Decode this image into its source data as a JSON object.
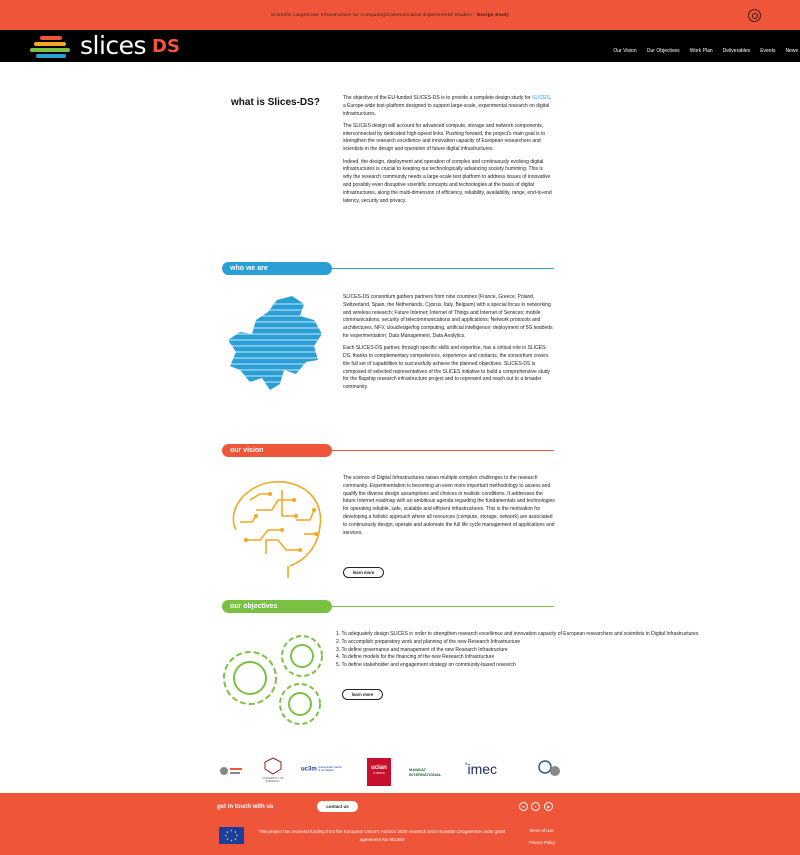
{
  "topbar": {
    "tagline_prefix": "Scientific LargeScale Infrastructure for Computing/Communication Experimental Studies - ",
    "tagline_bold": "Design Study"
  },
  "brand": {
    "name": "slices",
    "suffix": "DS",
    "bar_colors": [
      "#ee5539",
      "#f5a623",
      "#7ac143",
      "#2a9fd6"
    ]
  },
  "nav": {
    "items": [
      "Our Vision",
      "Our Objectives",
      "Work Plan",
      "Deliverables",
      "Events",
      "News"
    ]
  },
  "what": {
    "title": "what is Slices-DS?",
    "p1_pre": "The objective of the EU-funded SLICES-DS is to provide a complete design study for ",
    "p1_link": "SLICES",
    "p1_post": ", a Europe-wide test-platform designed to support large-scale, experimental research on digital infrastructures.",
    "p2": "The SLICES design will account for advanced compute, storage and network components, interconnected by dedicated high-speed links. Pushing forward, the project's main goal is to strengthen the research excellence and innovation capacity of European researchers and scientists in the design and operation of future digital infrastructures.",
    "p3": "Indeed, the design, deployment and operation of complex and continuously evolving digital infrastructures is crucial to keeping our technologically advancing society humming. This is why the research community needs a large-scale test platform to address issues of innovative and possibly even disruptive scientific concepts and technologies at the basis of digital infrastructures, along the multi-dimension of efficiency, reliability, availability, range, end-to-end latency, security and privacy."
  },
  "who": {
    "title": "who we are",
    "color": "#2a9fd6",
    "p1": "SLICES-DS consortium gathers partners from nine countries (France, Greece, Poland, Switzerland, Spain, the Netherlands, Cyprus, Italy, Belgium) with a special focus in networking and wireless research; Future Internet; Internet of Things and Internet of Services; mobile communications, security of telecommunications and applications; Network protocols and architectures, NFV, cloud/edge/fog computing, artificial intelligence; deployment of 5G testbeds for experimentation; Data Management, Data Analytics.",
    "p2": "Each SLICES-DS partner, through specific skills and expertise, has a critical role in SLICES-DS, thanks to complementary competences, experience and contacts, the consortium covers the full set of capabilities to successfully achieve the planned objectives. SLICES-DS is composed of selected representatives of the SLICES initiative to build a comprehensive study for the flagship research infrastructure project and to represent and reach out to a broader community."
  },
  "vision": {
    "title": "our vision",
    "color": "#ee5539",
    "text": "The science of Digital Infrastructures raises multiple complex challenges to the research community. Experimentation is becoming an even more important methodology to assess and qualify the diverse design assumptions and choices in realistic conditions. It addresses the future Internet roadmap with an ambitious agenda regarding the fundamentals and technologies for operating reliable, safe, scalable and efficient infrastructures. This is the motivation for developing a holistic approach where all resources (compute, storage, network) are associated to continuously design, operate and automate the full life cycle management of applications and services.",
    "button": "learn more"
  },
  "objectives": {
    "title": "our objectives",
    "color": "#7ac143",
    "items": [
      "1. To adequately design SLICES in order to strengthen research excellence and innovation capacity of European researchers and scientists in Digital Infrastructures",
      "2. To accomplish preparatory work and planning of the new Research Infrastructure",
      "3. To define governance and management of the new Research Infrastructure",
      "4. To define models for the financing of the new Research Infrastructure",
      "5. To define stakeholder and engagement strategy on community-based research"
    ],
    "button": "learn more"
  },
  "partners": {
    "thessaly": "UNIVERSITY OF THESSALY",
    "uc3m": "uc3m",
    "uc3m_sub": "Universidad Carlos III de Madrid",
    "uclan": "uclan",
    "uclan_sub": "CYPRUS",
    "mandat": "MANDAT INTERNATIONAL",
    "imec": "imec"
  },
  "footer": {
    "git": "get in touch with us",
    "contact": "contact us",
    "funding": "This project has received funding from the European Union's Horizon 2020 research and innovation programme under grant agreement No 951850",
    "terms": "Terms of Use",
    "privacy": "Privacy Policy"
  }
}
